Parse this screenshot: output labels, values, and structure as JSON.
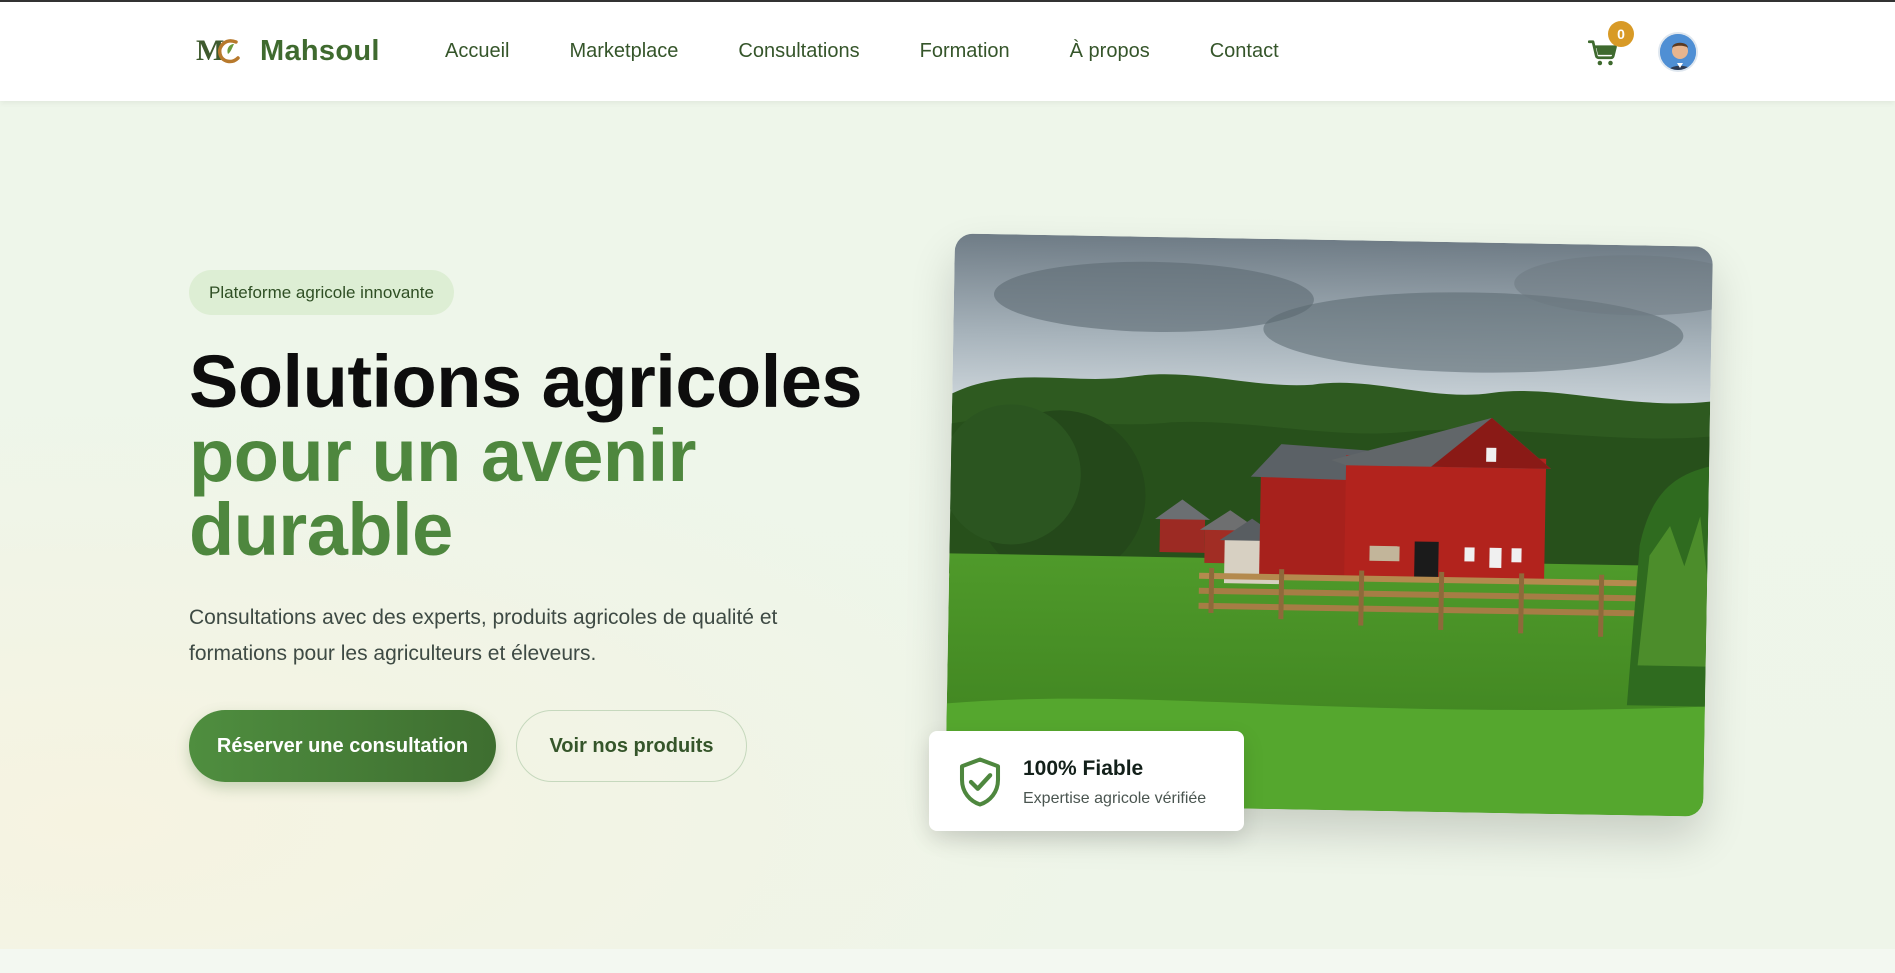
{
  "brand": {
    "name": "Mahsoul",
    "logo_letters": "MC"
  },
  "nav": {
    "items": [
      {
        "label": "Accueil"
      },
      {
        "label": "Marketplace"
      },
      {
        "label": "Consultations"
      },
      {
        "label": "Formation"
      },
      {
        "label": "À propos"
      },
      {
        "label": "Contact"
      }
    ]
  },
  "cart": {
    "count": "0",
    "icon": "cart-icon"
  },
  "user": {
    "icon": "avatar"
  },
  "hero": {
    "tag": "Plateforme agricole innovante",
    "title_line1": "Solutions agricoles",
    "title_line2": "pour un avenir",
    "title_line3": "durable",
    "description": "Consultations avec des experts, produits agricoles de qualité et formations pour les agriculteurs et éleveurs.",
    "primary_button": "Réserver une consultation",
    "secondary_button": "Voir nos produits"
  },
  "trust_card": {
    "icon": "shield-check-icon",
    "title": "100% Fiable",
    "subtitle": "Expertise agricole vérifiée"
  },
  "colors": {
    "brand_green": "#4e873e",
    "dark_green": "#3e6e30",
    "badge_orange": "#d89a26",
    "hero_bg": "#eef5ea"
  }
}
